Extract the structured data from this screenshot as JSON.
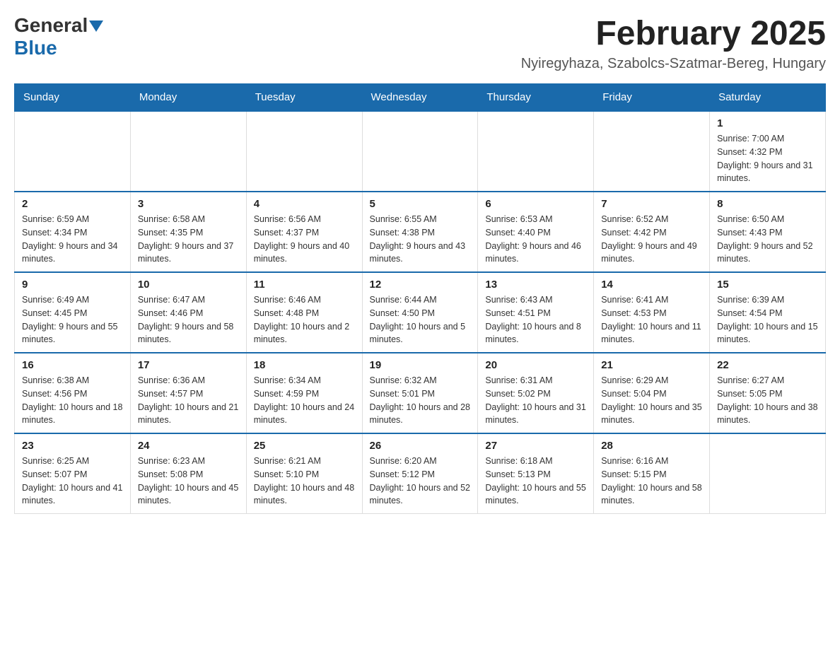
{
  "logo": {
    "general": "General",
    "blue": "Blue"
  },
  "header": {
    "month_year": "February 2025",
    "location": "Nyiregyhaza, Szabolcs-Szatmar-Bereg, Hungary"
  },
  "days_of_week": [
    "Sunday",
    "Monday",
    "Tuesday",
    "Wednesday",
    "Thursday",
    "Friday",
    "Saturday"
  ],
  "weeks": [
    [
      {
        "day": "",
        "info": ""
      },
      {
        "day": "",
        "info": ""
      },
      {
        "day": "",
        "info": ""
      },
      {
        "day": "",
        "info": ""
      },
      {
        "day": "",
        "info": ""
      },
      {
        "day": "",
        "info": ""
      },
      {
        "day": "1",
        "info": "Sunrise: 7:00 AM\nSunset: 4:32 PM\nDaylight: 9 hours and 31 minutes."
      }
    ],
    [
      {
        "day": "2",
        "info": "Sunrise: 6:59 AM\nSunset: 4:34 PM\nDaylight: 9 hours and 34 minutes."
      },
      {
        "day": "3",
        "info": "Sunrise: 6:58 AM\nSunset: 4:35 PM\nDaylight: 9 hours and 37 minutes."
      },
      {
        "day": "4",
        "info": "Sunrise: 6:56 AM\nSunset: 4:37 PM\nDaylight: 9 hours and 40 minutes."
      },
      {
        "day": "5",
        "info": "Sunrise: 6:55 AM\nSunset: 4:38 PM\nDaylight: 9 hours and 43 minutes."
      },
      {
        "day": "6",
        "info": "Sunrise: 6:53 AM\nSunset: 4:40 PM\nDaylight: 9 hours and 46 minutes."
      },
      {
        "day": "7",
        "info": "Sunrise: 6:52 AM\nSunset: 4:42 PM\nDaylight: 9 hours and 49 minutes."
      },
      {
        "day": "8",
        "info": "Sunrise: 6:50 AM\nSunset: 4:43 PM\nDaylight: 9 hours and 52 minutes."
      }
    ],
    [
      {
        "day": "9",
        "info": "Sunrise: 6:49 AM\nSunset: 4:45 PM\nDaylight: 9 hours and 55 minutes."
      },
      {
        "day": "10",
        "info": "Sunrise: 6:47 AM\nSunset: 4:46 PM\nDaylight: 9 hours and 58 minutes."
      },
      {
        "day": "11",
        "info": "Sunrise: 6:46 AM\nSunset: 4:48 PM\nDaylight: 10 hours and 2 minutes."
      },
      {
        "day": "12",
        "info": "Sunrise: 6:44 AM\nSunset: 4:50 PM\nDaylight: 10 hours and 5 minutes."
      },
      {
        "day": "13",
        "info": "Sunrise: 6:43 AM\nSunset: 4:51 PM\nDaylight: 10 hours and 8 minutes."
      },
      {
        "day": "14",
        "info": "Sunrise: 6:41 AM\nSunset: 4:53 PM\nDaylight: 10 hours and 11 minutes."
      },
      {
        "day": "15",
        "info": "Sunrise: 6:39 AM\nSunset: 4:54 PM\nDaylight: 10 hours and 15 minutes."
      }
    ],
    [
      {
        "day": "16",
        "info": "Sunrise: 6:38 AM\nSunset: 4:56 PM\nDaylight: 10 hours and 18 minutes."
      },
      {
        "day": "17",
        "info": "Sunrise: 6:36 AM\nSunset: 4:57 PM\nDaylight: 10 hours and 21 minutes."
      },
      {
        "day": "18",
        "info": "Sunrise: 6:34 AM\nSunset: 4:59 PM\nDaylight: 10 hours and 24 minutes."
      },
      {
        "day": "19",
        "info": "Sunrise: 6:32 AM\nSunset: 5:01 PM\nDaylight: 10 hours and 28 minutes."
      },
      {
        "day": "20",
        "info": "Sunrise: 6:31 AM\nSunset: 5:02 PM\nDaylight: 10 hours and 31 minutes."
      },
      {
        "day": "21",
        "info": "Sunrise: 6:29 AM\nSunset: 5:04 PM\nDaylight: 10 hours and 35 minutes."
      },
      {
        "day": "22",
        "info": "Sunrise: 6:27 AM\nSunset: 5:05 PM\nDaylight: 10 hours and 38 minutes."
      }
    ],
    [
      {
        "day": "23",
        "info": "Sunrise: 6:25 AM\nSunset: 5:07 PM\nDaylight: 10 hours and 41 minutes."
      },
      {
        "day": "24",
        "info": "Sunrise: 6:23 AM\nSunset: 5:08 PM\nDaylight: 10 hours and 45 minutes."
      },
      {
        "day": "25",
        "info": "Sunrise: 6:21 AM\nSunset: 5:10 PM\nDaylight: 10 hours and 48 minutes."
      },
      {
        "day": "26",
        "info": "Sunrise: 6:20 AM\nSunset: 5:12 PM\nDaylight: 10 hours and 52 minutes."
      },
      {
        "day": "27",
        "info": "Sunrise: 6:18 AM\nSunset: 5:13 PM\nDaylight: 10 hours and 55 minutes."
      },
      {
        "day": "28",
        "info": "Sunrise: 6:16 AM\nSunset: 5:15 PM\nDaylight: 10 hours and 58 minutes."
      },
      {
        "day": "",
        "info": ""
      }
    ]
  ]
}
